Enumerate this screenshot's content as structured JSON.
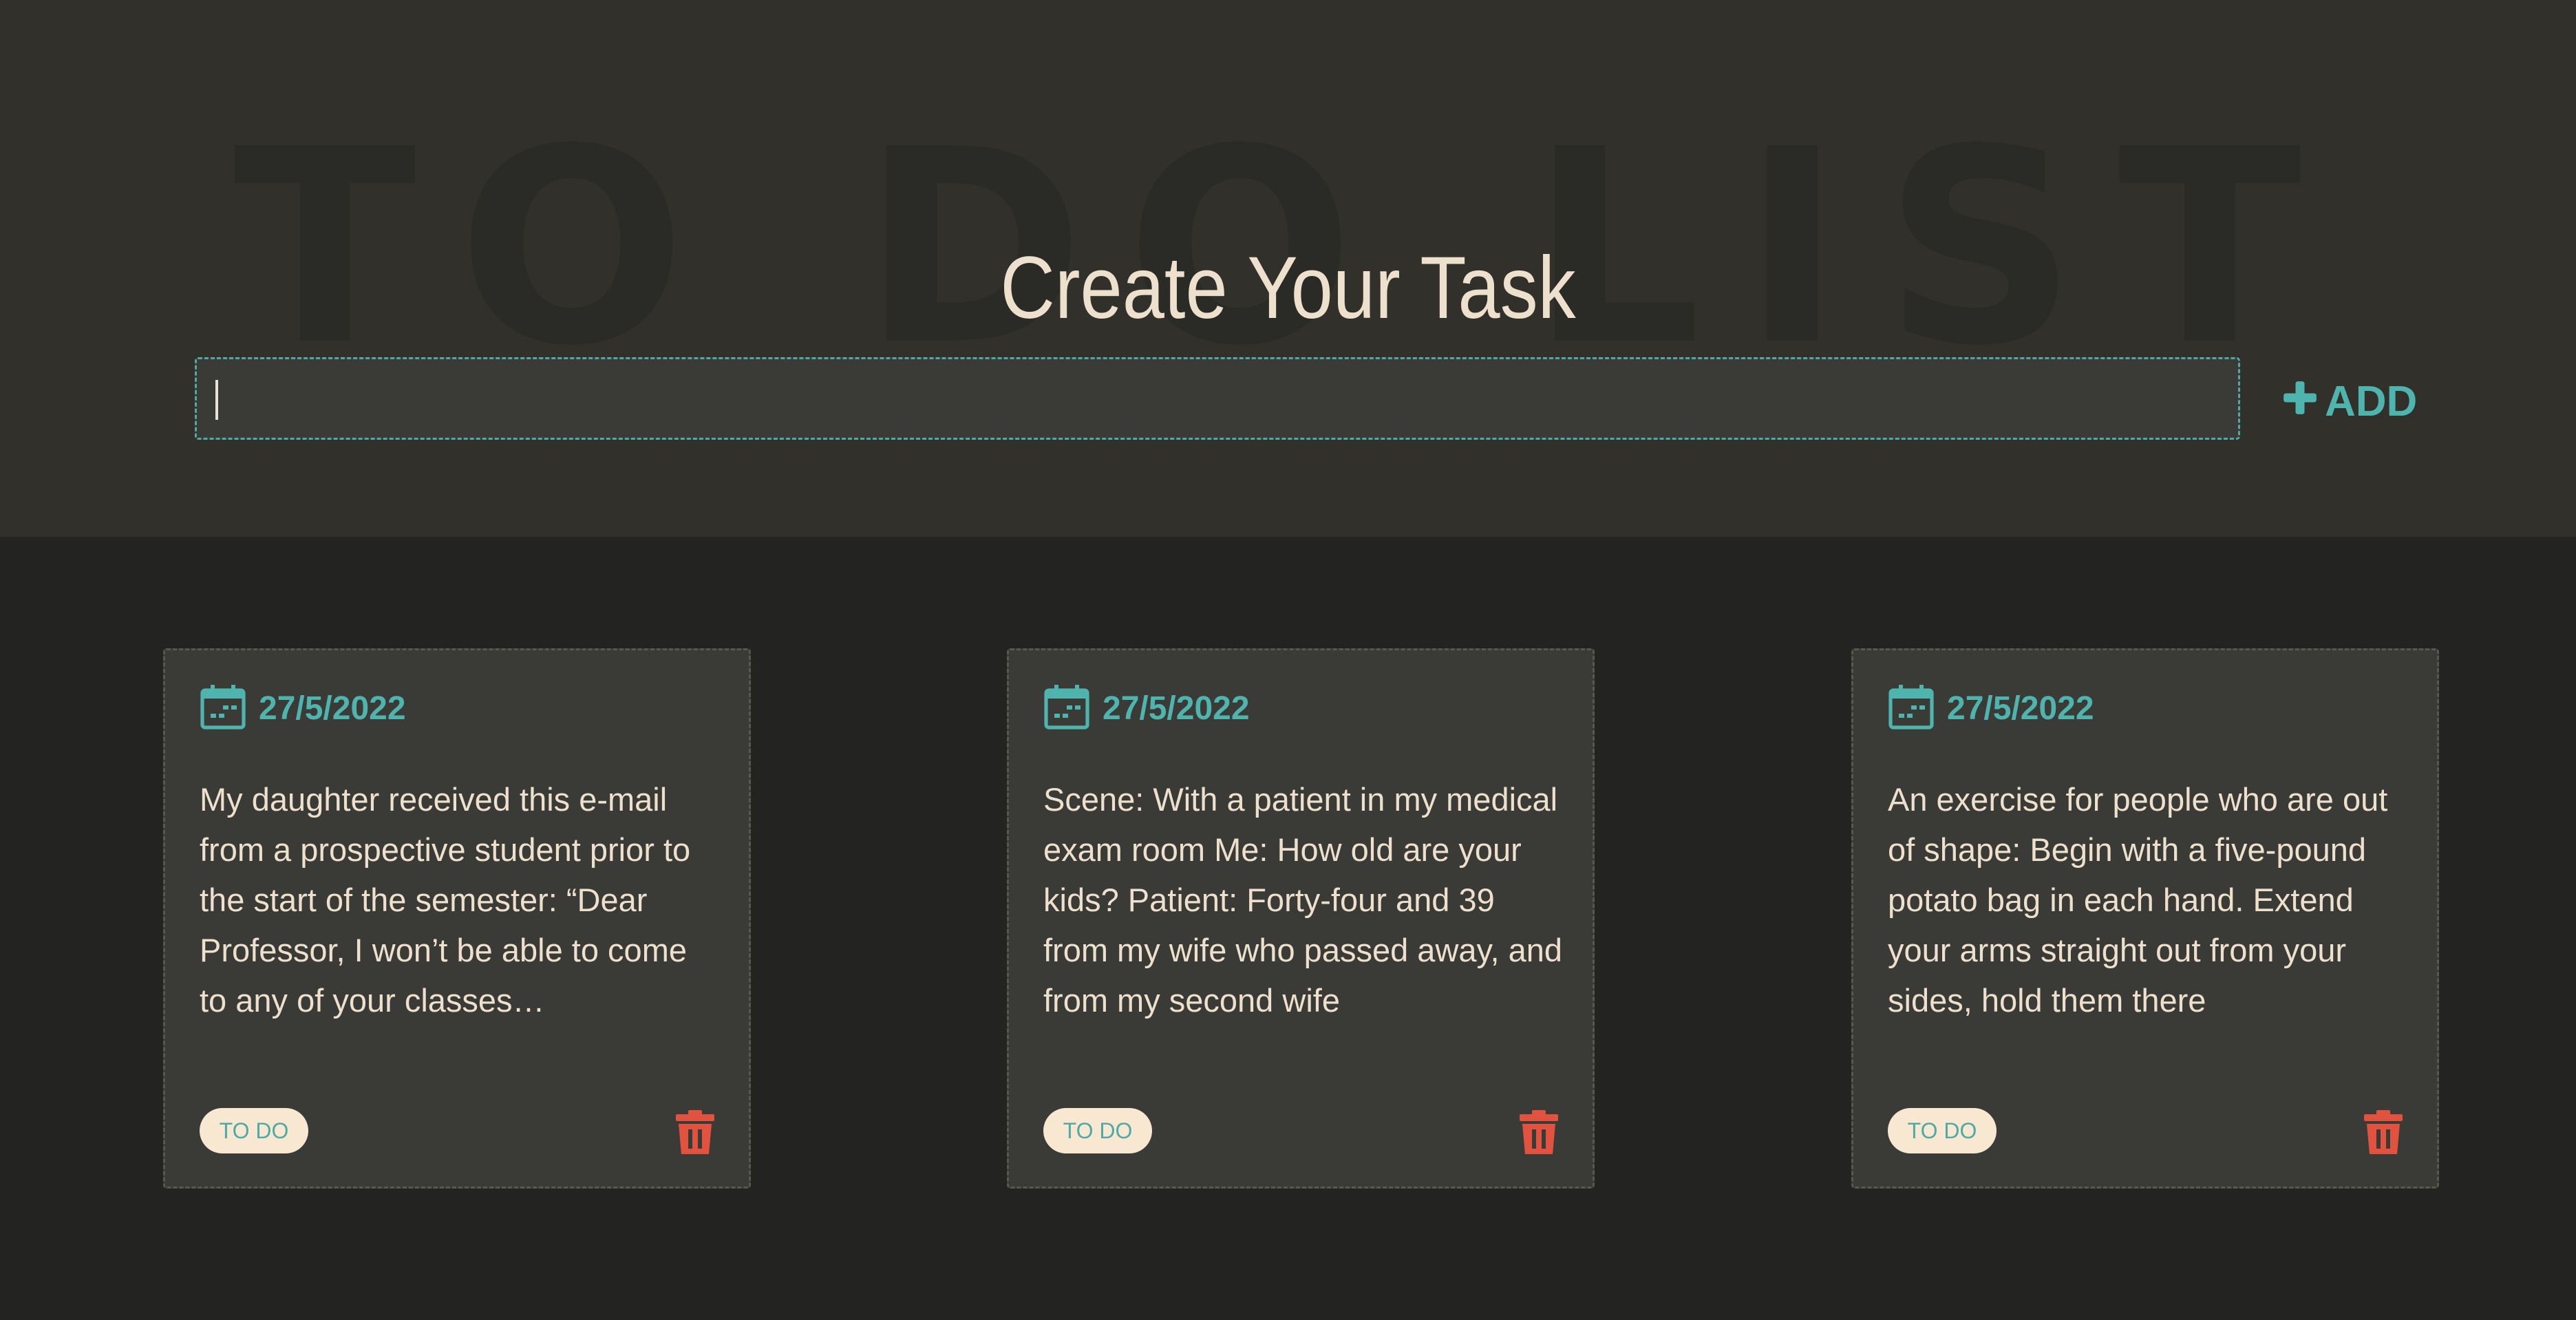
{
  "header": {
    "background_word": "TO DO LIST",
    "title": "Create Your Task",
    "input": {
      "value": "",
      "placeholder": ""
    },
    "add_button": {
      "label": "ADD",
      "icon": "plus-icon"
    }
  },
  "tasks": [
    {
      "date": "27/5/2022",
      "text": "My daughter received this e-mail from a prospective student prior to the start of the semester: “Dear Professor, I won’t be able to come to any of your classes…",
      "status": "TO DO",
      "date_icon": "calendar-icon",
      "delete_icon": "trash-icon"
    },
    {
      "date": "27/5/2022",
      "text": "Scene: With a patient in my medical exam room Me: How old are your kids? Patient: Forty-four and 39 from my wife who passed away, and from my second wife",
      "status": "TO DO",
      "date_icon": "calendar-icon",
      "delete_icon": "trash-icon"
    },
    {
      "date": "27/5/2022",
      "text": "An exercise for people who are out of shape: Begin with a five-pound potato bag in each hand. Extend your arms straight out from your sides, hold them there",
      "status": "TO DO",
      "date_icon": "calendar-icon",
      "delete_icon": "trash-icon"
    }
  ],
  "colors": {
    "accent": "#4fb3ae",
    "text_light": "#ede0cc",
    "danger": "#e1533f",
    "badge_bg": "#f8e8d1",
    "header_bg": "#31302b",
    "body_bg": "#232321",
    "card_bg": "#3a3a36"
  }
}
